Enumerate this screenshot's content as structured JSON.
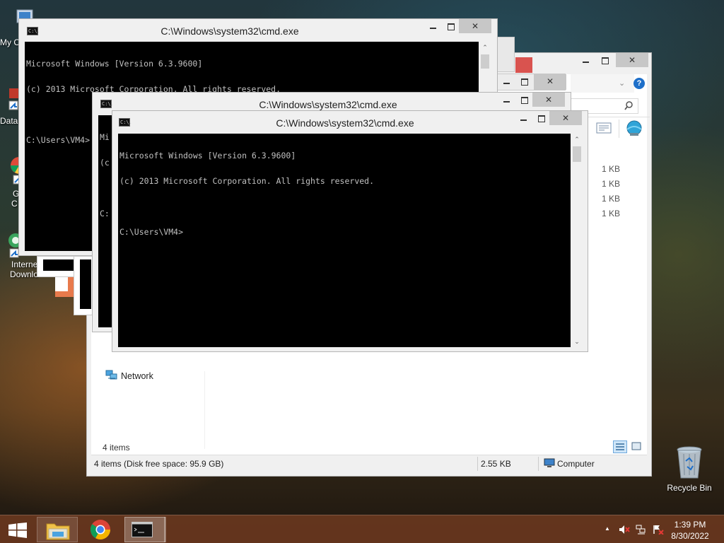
{
  "desktop": {
    "icons": [
      {
        "label": "My C"
      },
      {
        "label": "Data"
      },
      {
        "label": "G"
      },
      {
        "label": "C"
      },
      {
        "label": "Interne"
      },
      {
        "label": "Downlo"
      },
      {
        "label": "Recycle Bin"
      }
    ]
  },
  "cmd_window_back": {
    "title": "C:\\Windows\\system32\\cmd.exe",
    "icon_text": "C:\\.",
    "lines": [
      "Microsoft Windows [Version 6.3.9600]",
      "(c) 2013 Microsoft Corporation. All rights reserved.",
      "",
      "C:\\Users\\VM4>"
    ]
  },
  "cmd_window_middle": {
    "title": "C:\\Windows\\system32\\cmd.exe",
    "icon_text": "C:\\.",
    "lines": [
      "Mi",
      "(c",
      "",
      "C:"
    ]
  },
  "cmd_window_front": {
    "title": "C:\\Windows\\system32\\cmd.exe",
    "icon_text": "C:\\.",
    "lines": [
      "Microsoft Windows [Version 6.3.9600]",
      "(c) 2013 Microsoft Corporation. All rights reserved.",
      "",
      "C:\\Users\\VM4>"
    ]
  },
  "explorer": {
    "help_label": "?",
    "file_sizes": [
      "1 KB",
      "1 KB",
      "1 KB",
      "1 KB"
    ],
    "nav_network": "Network",
    "item_count": "4 items",
    "status": {
      "items_info": "4 items (Disk free space: 95.9 GB)",
      "size": "2.55 KB",
      "location": "Computer"
    }
  },
  "taskbar": {
    "clock_time": "1:39 PM",
    "clock_date": "8/30/2022",
    "tray_arrow": "▲"
  },
  "colors": {
    "taskbar": "#69371e",
    "console_bg": "#000000",
    "console_text": "#c0c0c0",
    "help_blue": "#1e6fc9"
  }
}
